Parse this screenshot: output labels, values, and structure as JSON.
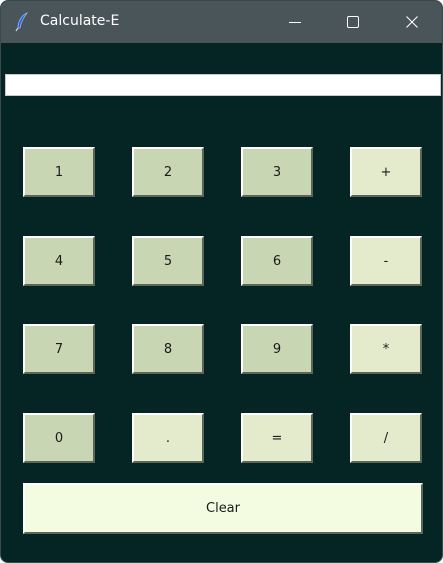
{
  "window": {
    "title": "Calculate-E",
    "icon": "feather-icon"
  },
  "display": {
    "value": ""
  },
  "keypad": {
    "rows": [
      [
        "1",
        "2",
        "3",
        "+"
      ],
      [
        "4",
        "5",
        "6",
        "-"
      ],
      [
        "7",
        "8",
        "9",
        "*"
      ],
      [
        "0",
        ".",
        "=",
        "/"
      ]
    ],
    "clear_label": "Clear"
  },
  "colors": {
    "background": "#052424",
    "number_button": "#c8d6b3",
    "operator_button": "#e4ebcc",
    "clear_button": "#f3fbe1",
    "titlebar": "#4a5559"
  }
}
